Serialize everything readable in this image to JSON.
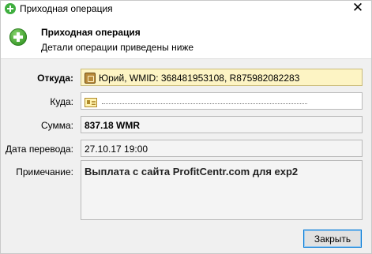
{
  "window": {
    "title": "Приходная операция",
    "close_glyph": "✕"
  },
  "header": {
    "title": "Приходная операция",
    "subtitle": "Детали операции приведены ниже"
  },
  "fields": {
    "from": {
      "label": "Откуда:",
      "value": "Юрий, WMID: 368481953108, R875982082283"
    },
    "to": {
      "label": "Куда:",
      "value": ""
    },
    "amount": {
      "label": "Сумма:",
      "value": "837.18 WMR"
    },
    "date": {
      "label": "Дата перевода:",
      "value": "27.10.17 19:00"
    },
    "note": {
      "label": "Примечание:",
      "value": "Выплата с сайта ProfitCentr.com для exp2"
    }
  },
  "buttons": {
    "close": "Закрыть"
  },
  "icons": {
    "title": "green-plus-icon",
    "header": "green-plus-icon",
    "from": "purse-icon",
    "to": "wallet-card-icon"
  }
}
